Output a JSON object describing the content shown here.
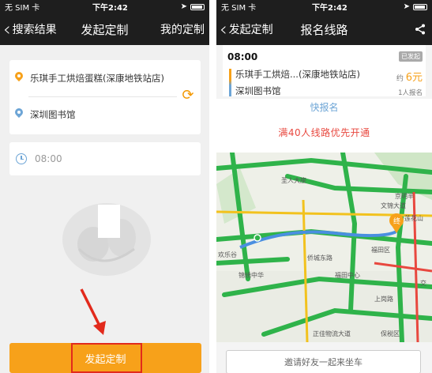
{
  "left": {
    "status": {
      "carrier": "无 SIM 卡",
      "time": "下午2:42"
    },
    "nav": {
      "back_label": "搜索结果",
      "title": "发起定制",
      "right_label": "我的定制"
    },
    "from_address": "乐琪手工烘焙蛋糕(深康地铁站店)",
    "to_address": "深圳图书馆",
    "time_value": "08:00",
    "submit_label": "发起定制"
  },
  "right": {
    "status": {
      "carrier": "无 SIM 卡",
      "time": "下午2:42"
    },
    "nav": {
      "back_label": "发起定制",
      "title": "报名线路"
    },
    "route": {
      "time": "08:00",
      "badge": "已发起",
      "from": "乐琪手工烘焙...(深康地铁站店)",
      "to": "深圳图书馆",
      "price_prefix": "约",
      "price": "6元",
      "enrolled": "1人报名"
    },
    "promo": {
      "top_text": "快报名",
      "main_text": "满40人线路优先开通"
    },
    "map": {
      "labels": [
        "圣人大座",
        "京明半",
        "莲花山",
        "文锦大道",
        "福田区",
        "欢乐谷",
        "锦绣中华",
        "侨城东路",
        "福田中心",
        "正佳物流大道",
        "保税区",
        "上岗路",
        "交",
        "终"
      ]
    },
    "invite_label": "邀请好友一起来坐车"
  },
  "colors": {
    "accent": "#f7a11a",
    "nav_bg": "#1e1e1e",
    "highlight_red": "#e22a1c",
    "promo_red": "#e8483f",
    "blue": "#6da5d6"
  }
}
